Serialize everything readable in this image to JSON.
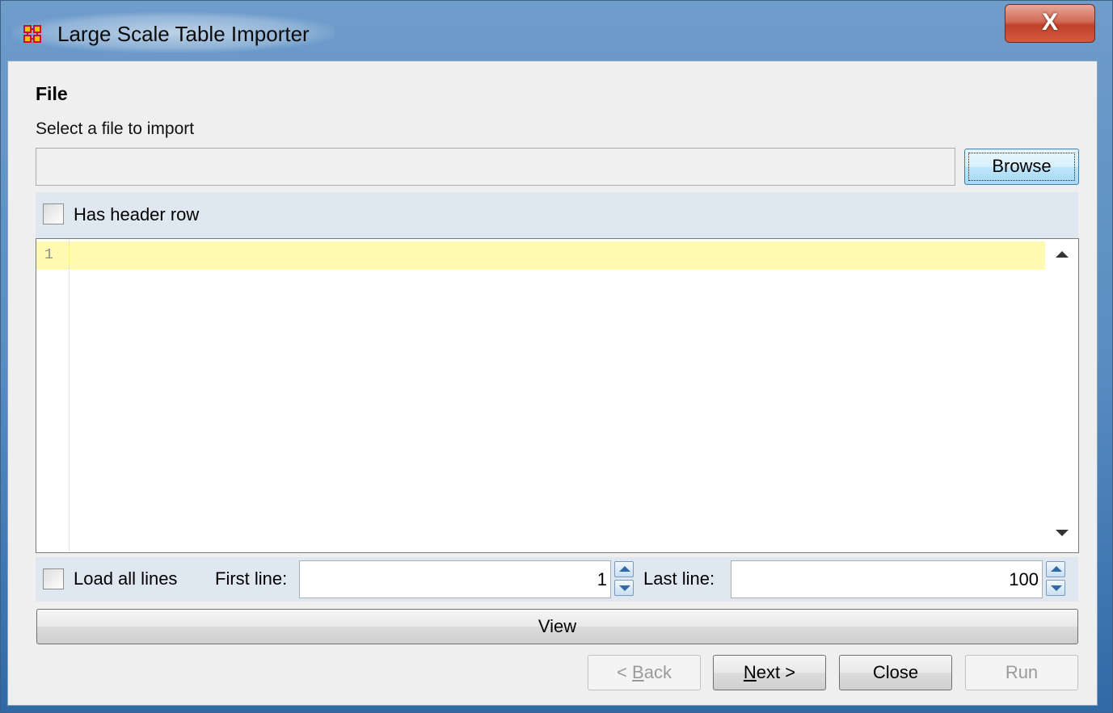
{
  "window": {
    "title": "Large Scale Table Importer",
    "close_label": "X"
  },
  "file_section": {
    "heading": "File",
    "prompt": "Select a file to import",
    "path_value": "",
    "browse_label": "Browse",
    "header_row_label": "Has header row",
    "header_row_checked": false
  },
  "editor": {
    "line_numbers": [
      "1"
    ],
    "content": ""
  },
  "range": {
    "load_all_label": "Load all lines",
    "load_all_checked": false,
    "first_line_label": "First line:",
    "first_line_value": "1",
    "last_line_label": "Last line:",
    "last_line_value": "100"
  },
  "actions": {
    "view_label": "View",
    "back_prefix": "< ",
    "back_mnemonic": "B",
    "back_rest": "ack",
    "next_mnemonic": "N",
    "next_rest": "ext >",
    "close_label": "Close",
    "run_label": "Run"
  },
  "colors": {
    "current_line_highlight": "#fffaaf",
    "title_bar": "#5a8dc2",
    "close_button": "#c0412a"
  },
  "icons": {
    "app": "network-grid-icon",
    "close": "close-icon",
    "scroll_up": "arrow-up-icon",
    "scroll_down": "arrow-down-icon"
  }
}
